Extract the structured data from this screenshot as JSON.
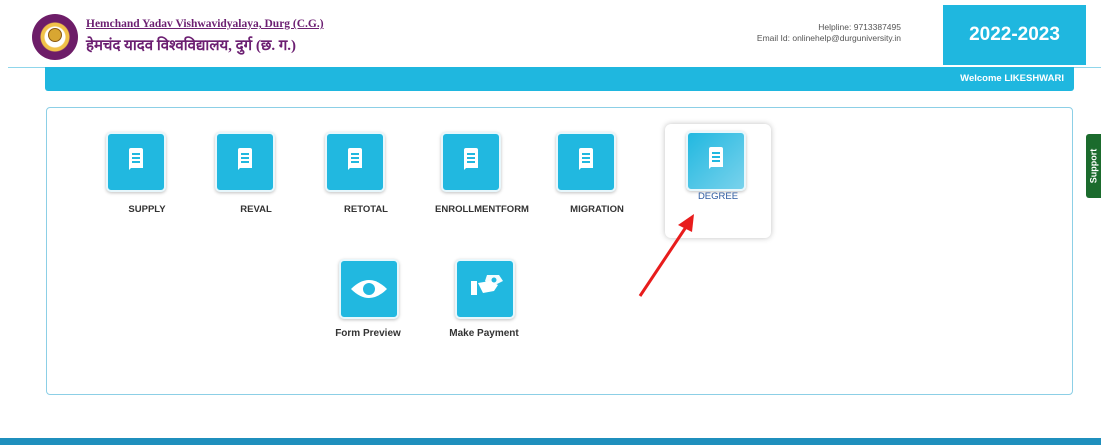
{
  "header": {
    "university_en": "Hemchand Yadav Vishwavidyalaya, Durg (C.G.)",
    "university_hi": "हेमचंद यादव विश्वविद्यालय, दुर्ग (छ. ग.)",
    "helpline": "Helpline: 9713387495",
    "email": "Email Id: onlinehelp@durguniversity.in",
    "session": "2022-2023"
  },
  "nav": {
    "welcome": "Welcome LIKESHWARI"
  },
  "tiles": [
    {
      "label": "SUPPLY",
      "icon": "document-icon"
    },
    {
      "label": "REVAL",
      "icon": "document-icon"
    },
    {
      "label": "RETOTAL",
      "icon": "document-icon"
    },
    {
      "label": "ENROLLMENTFORM",
      "icon": "document-icon"
    },
    {
      "label": "MIGRATION",
      "icon": "document-icon"
    },
    {
      "label": "DEGREE",
      "icon": "document-icon"
    }
  ],
  "actions": [
    {
      "label": "Form Preview",
      "icon": "eye-icon"
    },
    {
      "label": "Make Payment",
      "icon": "payment-icon"
    }
  ],
  "support": {
    "label": "Support"
  },
  "colors": {
    "accent": "#1fb7df",
    "brand_text": "#6c1f72",
    "support_green": "#1b6b2d",
    "annotation_arrow": "#e81c1c"
  }
}
